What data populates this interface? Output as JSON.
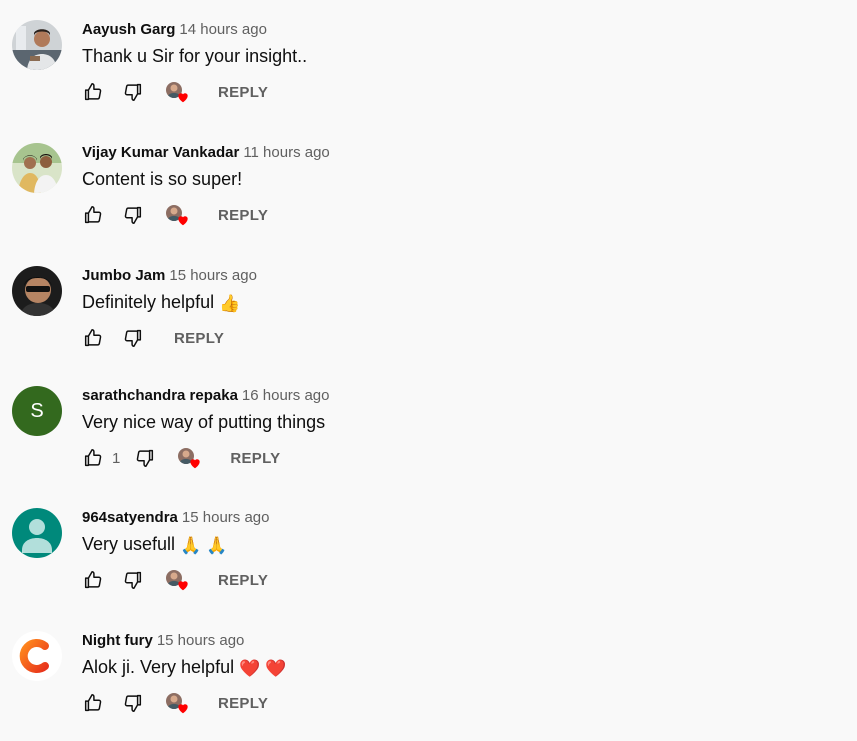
{
  "reply_label": "REPLY",
  "comments": [
    {
      "author": "Aayush Garg",
      "time": "14 hours ago",
      "text": "Thank u Sir for your insight..",
      "emoji": "",
      "likes": "",
      "hearted": true,
      "avatar": "photo-man-desk"
    },
    {
      "author": "Vijay Kumar Vankadar",
      "time": "11 hours ago",
      "text": "Content is so super!",
      "emoji": "",
      "likes": "",
      "hearted": true,
      "avatar": "photo-couple"
    },
    {
      "author": "Jumbo Jam",
      "time": "15 hours ago",
      "text": "Definitely helpful",
      "emoji": "👍",
      "likes": "",
      "hearted": false,
      "avatar": "photo-man-sunglasses"
    },
    {
      "author": "sarathchandra repaka",
      "time": "16 hours ago",
      "text": "Very nice way of putting things",
      "emoji": "",
      "likes": "1",
      "hearted": true,
      "avatar": "letter",
      "avatar_letter": "S",
      "avatar_color": "#33691e"
    },
    {
      "author": "964satyendra",
      "time": "15 hours ago",
      "text": "Very usefull",
      "emoji": "🙏 🙏",
      "likes": "",
      "hearted": true,
      "avatar": "default-person",
      "avatar_color": "#00897b"
    },
    {
      "author": "Night fury",
      "time": "15 hours ago",
      "text": "Alok ji. Very helpful",
      "emoji": "❤️ ❤️",
      "likes": "",
      "hearted": true,
      "avatar": "logo-c"
    }
  ],
  "colors": {
    "background": "#f9f9f9",
    "author_text": "#0f0f0f",
    "secondary_text": "#606060",
    "heart": "#ff0000"
  }
}
